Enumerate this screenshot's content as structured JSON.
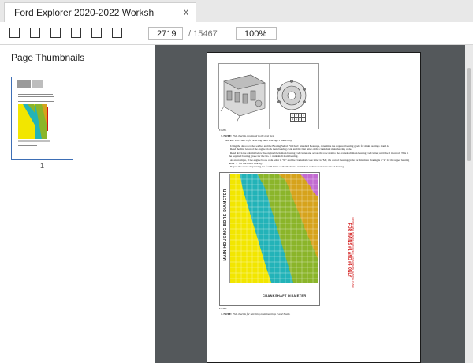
{
  "tab": {
    "title": "Ford Explorer 2020-2022 Worksh",
    "close": "x"
  },
  "toolbar": {
    "page_current": "2719",
    "page_total": "/ 15467",
    "zoom": "100%"
  },
  "sidebar": {
    "title": "Page Thumbnails",
    "thumbnail_label": "1"
  },
  "document": {
    "figure_id": "E172891",
    "callout_table": [
      [
        "1",
        "2",
        "3",
        "4"
      ],
      [
        "4",
        "3",
        "2",
        "1"
      ]
    ],
    "note1_label": "3. NOTE:",
    "note1_text": "This chart is continued in the next step.",
    "note2_label": "NOTE:",
    "note2_text": "This chart is for selecting main bearings 1 and 4 only.",
    "bullets": [
      "Using the data recorded earlier and the Bearing Select Fit Chart: Standard Bearings, determine the required bearing grade for main bearings 1 and 4.",
      "Read the first letter of the engine block main bearing code and the first letter of the crankshaft main bearing code.",
      "Read down the column below the engine block main bearing code letter and across the row next to the crankshaft main bearing code letter; until the 2 intersect. This is the required bearing grade for the No. 1 crankshaft main bearing.",
      "As an example, if the engine block code letter is \"M\" and the crankshaft code letter is \"M\", the correct bearing grade for this main bearing is a \"2\" for the upper bearing and a \"2\" for the lower bearing.",
      "Repeat the above steps using the fourth letter of the block and crankshaft codes to select the No. 4 bearing."
    ],
    "chart_vertical_label": "MAIN HOUSING BORE DIAMETER",
    "chart_bottom_label": "CRANKSHAFT DIAMETER",
    "chart_red_label": "FOR MAINS #1 AND #4 ONLY",
    "chart_red_sublabel": "(UPPER MAIN BEARING GROOVED / LOWER MAIN BEARING PLAIN)",
    "chart_ref": "E172896",
    "note3_label": "4. NOTE:",
    "note3_text": "This chart is for selecting main bearings 2 and 3 only."
  },
  "colors": {
    "grade_1": "#f2e600",
    "grade_2": "#23b3b8",
    "grade_3": "#8bb52a",
    "grade_4": "#d6a31c",
    "grade_5": "#c26bd0",
    "red_label": "#d21818",
    "thumb_border": "#3d6eb5",
    "viewer_bg": "#54585b"
  }
}
